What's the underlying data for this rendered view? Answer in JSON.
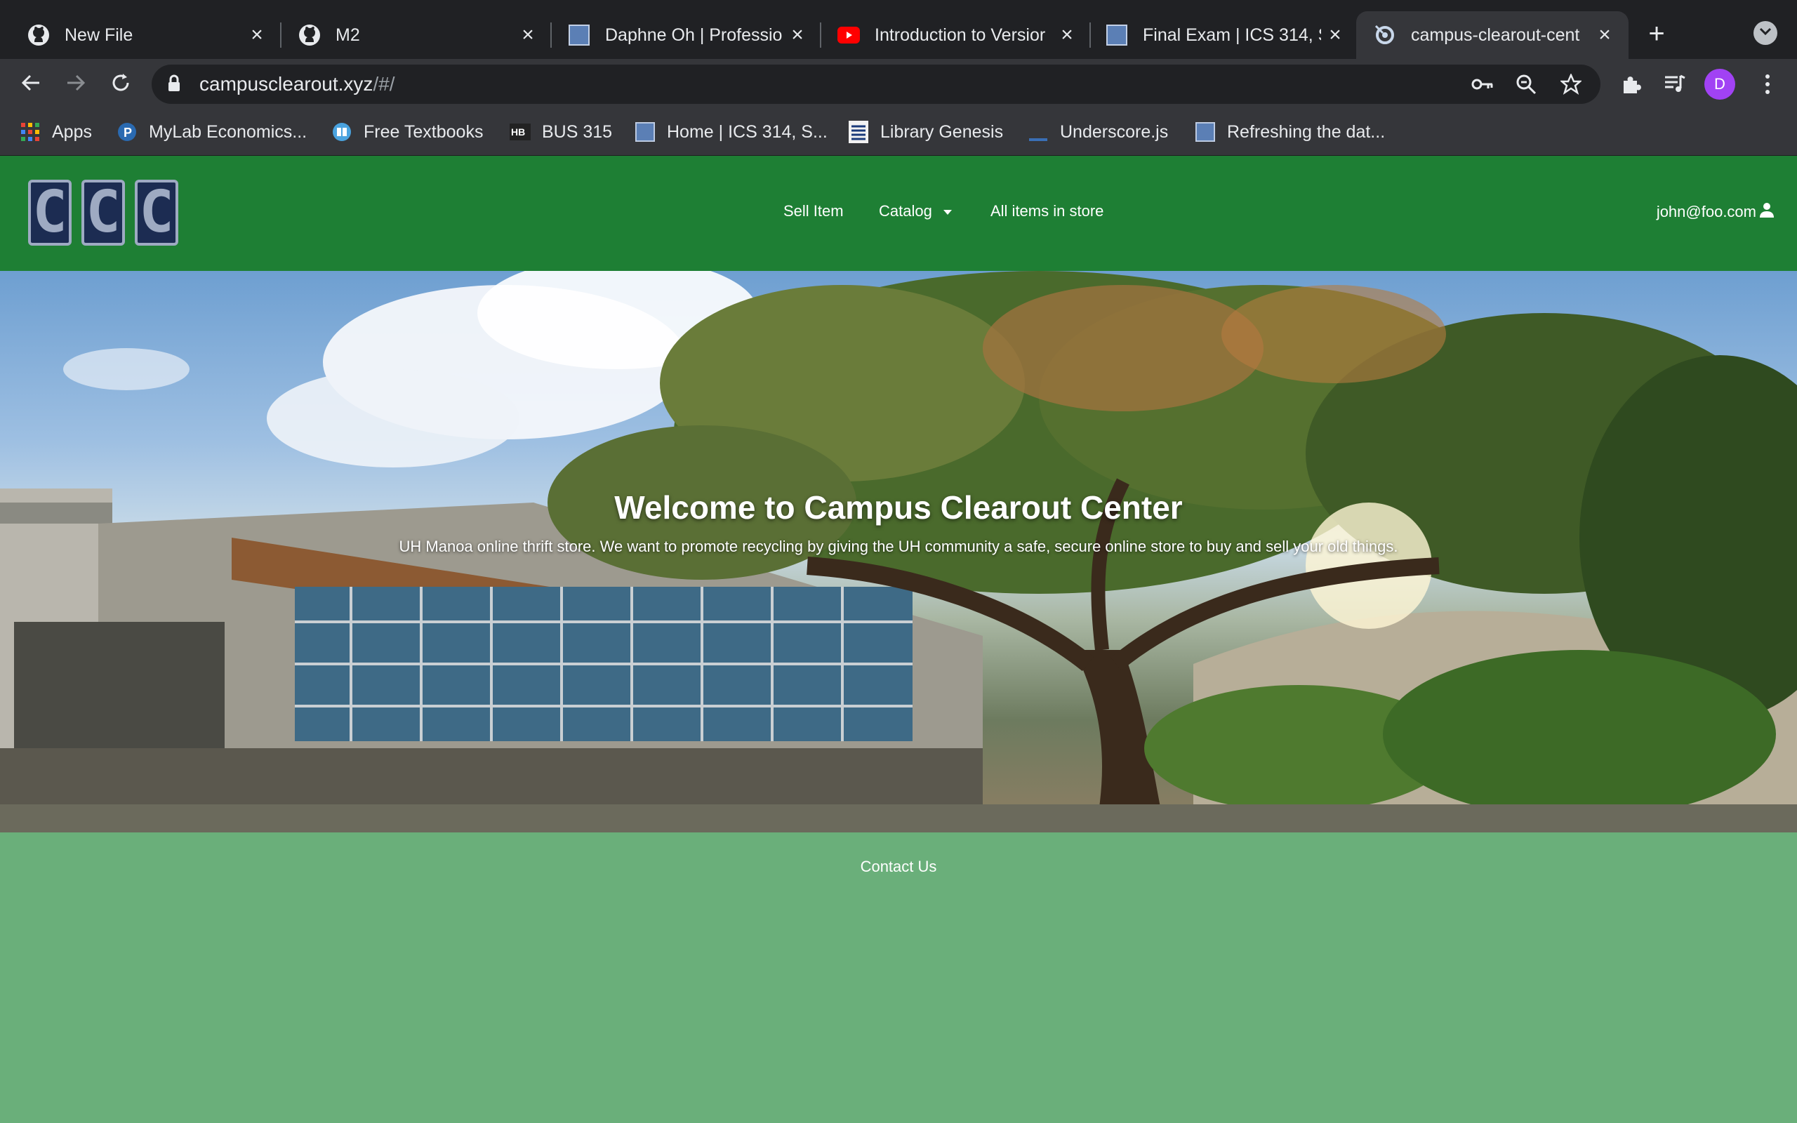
{
  "browser": {
    "tabs": [
      {
        "title": "New File",
        "icon": "github-icon",
        "active": false
      },
      {
        "title": "M2",
        "icon": "github-icon",
        "active": false
      },
      {
        "title": "Daphne Oh | Professio",
        "icon": "canvas-icon",
        "active": false
      },
      {
        "title": "Introduction to Versior",
        "icon": "youtube-icon",
        "active": false
      },
      {
        "title": "Final Exam | ICS 314, S",
        "icon": "canvas-icon",
        "active": false
      },
      {
        "title": "campus-clearout-cent",
        "icon": "meteor-icon",
        "active": true
      }
    ],
    "url_host": "campusclearout.xyz",
    "url_path": "/#/",
    "profile_initial": "D",
    "bookmarks": [
      {
        "label": "Apps",
        "icon": "apps-grid-icon"
      },
      {
        "label": "MyLab Economics...",
        "icon": "pearson-icon"
      },
      {
        "label": "Free Textbooks",
        "icon": "book-icon"
      },
      {
        "label": "BUS 315",
        "icon": "hb-icon"
      },
      {
        "label": "Home | ICS 314, S...",
        "icon": "canvas-icon"
      },
      {
        "label": "Library Genesis",
        "icon": "library-icon"
      },
      {
        "label": "Underscore.js",
        "icon": "underscore-icon"
      },
      {
        "label": "Refreshing the dat...",
        "icon": "canvas-icon"
      }
    ]
  },
  "site": {
    "logo_letters": [
      "C",
      "C",
      "C"
    ],
    "nav": {
      "sell_item": "Sell Item",
      "catalog": "Catalog",
      "all_items": "All items in store",
      "user_email": "john@foo.com"
    },
    "hero": {
      "title": "Welcome to Campus Clearout Center",
      "subtitle": "UH Manoa online thrift store. We want to promote recycling by giving the UH community a safe, secure online store to buy and sell your old things."
    },
    "footer": {
      "contact": "Contact Us"
    },
    "colors": {
      "navbar": "#1e7f34",
      "footer": "#6aaf7a"
    }
  }
}
